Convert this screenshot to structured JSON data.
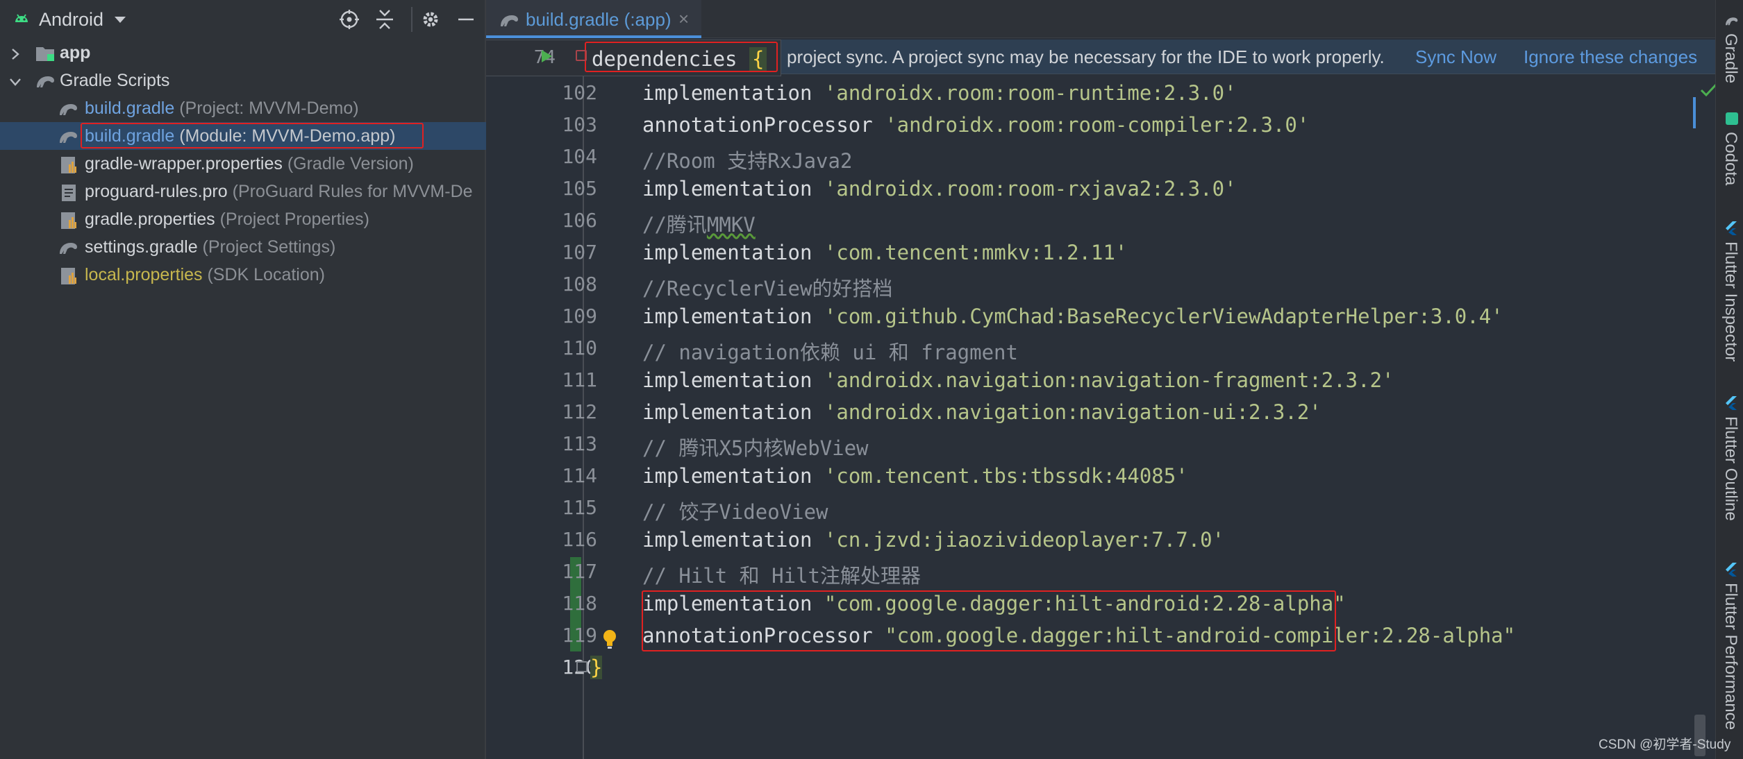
{
  "sidebar": {
    "view_label": "Android",
    "tree": [
      {
        "name": "app",
        "hint": ""
      },
      {
        "name": "Gradle Scripts",
        "hint": ""
      },
      {
        "name": "build.gradle",
        "hint": " (Project: MVVM-Demo)"
      },
      {
        "name": "build.gradle",
        "hint": " (Module: MVVM-Demo.app)"
      },
      {
        "name": "gradle-wrapper.properties",
        "hint": " (Gradle Version)"
      },
      {
        "name": "proguard-rules.pro",
        "hint": " (ProGuard Rules for MVVM-De"
      },
      {
        "name": "gradle.properties",
        "hint": " (Project Properties)"
      },
      {
        "name": "settings.gradle",
        "hint": " (Project Settings)"
      },
      {
        "name": "local.properties",
        "hint": " (SDK Location)"
      }
    ]
  },
  "editor": {
    "tab_label": "build.gradle (:app)",
    "notification": "project sync. A project sync may be necessary for the IDE to work properly.",
    "sync_now": "Sync Now",
    "ignore_changes": "Ignore these changes",
    "sticky": {
      "line": "74",
      "code": "dependencies "
    },
    "lines": [
      {
        "num": "102",
        "kw": "implementation ",
        "str": "'androidx.room:room-runtime:2.3.0'"
      },
      {
        "num": "103",
        "kw": "annotationProcessor ",
        "str": "'androidx.room:room-compiler:2.3.0'"
      },
      {
        "num": "104",
        "cmt": "//Room 支持RxJava2"
      },
      {
        "num": "105",
        "kw": "implementation ",
        "str": "'androidx.room:room-rxjava2:2.3.0'"
      },
      {
        "num": "106",
        "cmt": "//腾讯",
        "cmt2": "MMKV"
      },
      {
        "num": "107",
        "kw": "implementation ",
        "str": "'com.tencent:mmkv:1.2.11'"
      },
      {
        "num": "108",
        "cmt": "//RecyclerView的好搭档"
      },
      {
        "num": "109",
        "kw": "implementation ",
        "str": "'com.github.CymChad:BaseRecyclerViewAdapterHelper:3.0.4'"
      },
      {
        "num": "110",
        "cmt": "// navigation依赖 ui 和 fragment"
      },
      {
        "num": "111",
        "kw": "implementation ",
        "str": "'androidx.navigation:navigation-fragment:2.3.2'"
      },
      {
        "num": "112",
        "kw": "implementation ",
        "str": "'androidx.navigation:navigation-ui:2.3.2'"
      },
      {
        "num": "113",
        "cmt": "// 腾讯X5内核WebView"
      },
      {
        "num": "114",
        "kw": "implementation ",
        "str": "'com.tencent.tbs:tbssdk:44085'"
      },
      {
        "num": "115",
        "cmt": "// 饺子VideoView"
      },
      {
        "num": "116",
        "kw": "implementation ",
        "str": "'cn.jzvd:jiaozivideoplayer:7.7.0'"
      },
      {
        "num": "117",
        "cmt": "// Hilt 和 Hilt注解处理器"
      },
      {
        "num": "118",
        "kw": "implementation ",
        "str": "\"com.google.dagger:hilt-android:2.28-alpha\""
      },
      {
        "num": "119",
        "kw": "annotationProcessor ",
        "str": "\"com.google.dagger:hilt-android-compiler:2.28-alpha\""
      },
      {
        "num": "120",
        "end": "}"
      }
    ]
  },
  "right_strip": {
    "tabs": [
      "Gradle",
      "Codota",
      "Flutter Inspector",
      "Flutter Outline",
      "Flutter Performance"
    ]
  },
  "watermark": "CSDN @初学者-Study"
}
